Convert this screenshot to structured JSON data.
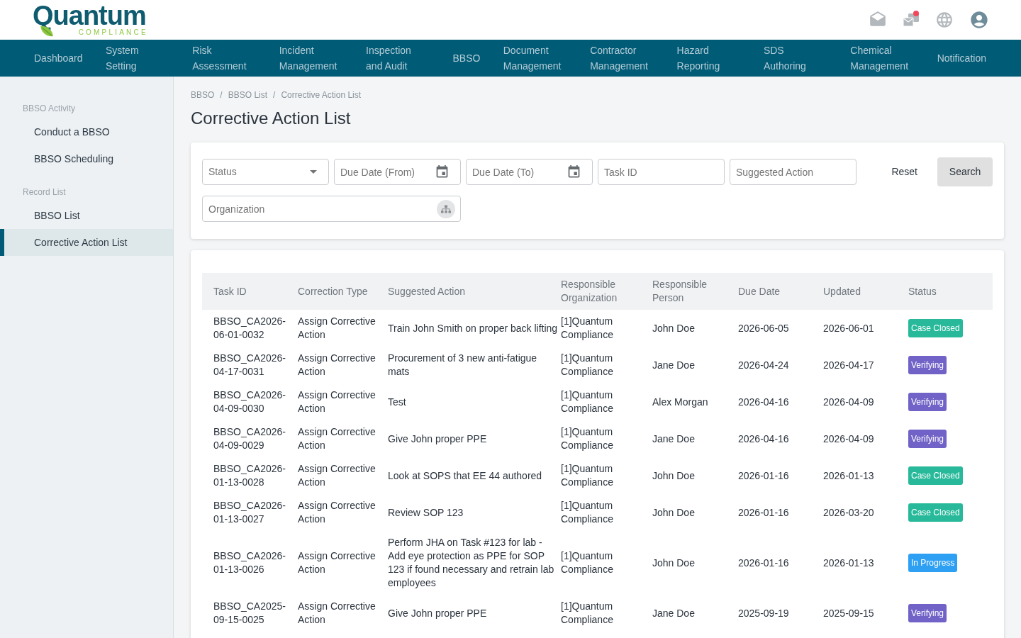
{
  "logo": {
    "name": "Quantum",
    "tagline": "COMPLIANCE"
  },
  "header": {
    "unread": true
  },
  "nav": [
    "Dashboard",
    "System Setting",
    "Risk Assessment",
    "Incident Management",
    "Inspection and Audit",
    "BBSO",
    "Document Management",
    "Contractor Management",
    "Hazard Reporting",
    "SDS Authoring",
    "Chemical Management",
    "Notification"
  ],
  "sidebar": {
    "sections": [
      {
        "title": "BBSO Activity",
        "items": [
          {
            "label": "Conduct a BBSO",
            "selected": false
          },
          {
            "label": "BBSO Scheduling",
            "selected": false
          }
        ]
      },
      {
        "title": "Record List",
        "items": [
          {
            "label": "BBSO List",
            "selected": false
          },
          {
            "label": "Corrective Action List",
            "selected": true
          }
        ]
      }
    ]
  },
  "breadcrumb": {
    "separator": "/",
    "items": [
      "BBSO",
      "BBSO List",
      "Corrective Action List"
    ]
  },
  "page_title": "Corrective Action List",
  "filters": {
    "fields": [
      {
        "kind": "select",
        "placeholder": "Status"
      },
      {
        "kind": "date",
        "placeholder": "Due Date (From)"
      },
      {
        "kind": "date",
        "placeholder": "Due Date (To)"
      },
      {
        "kind": "text",
        "placeholder": "Task ID"
      },
      {
        "kind": "text",
        "placeholder": "Suggested Action"
      },
      {
        "kind": "org",
        "placeholder": "Organization"
      }
    ],
    "buttons": [
      {
        "kind": "plain",
        "label": "Reset"
      },
      {
        "kind": "filled",
        "label": "Search"
      }
    ]
  },
  "table": {
    "columns": [
      "Task ID",
      "Correction Type",
      "Suggested Action",
      "Responsible Organization",
      "Responsible Person",
      "Due Date",
      "Updated",
      "Status"
    ],
    "rows": [
      {
        "task_id": "BBSO_CA2026-06-01-0032",
        "correction_type": "Assign Corrective Action",
        "suggested_action": "Train John Smith on proper back lifting",
        "organization": "[1]Quantum Compliance",
        "person": "John Doe",
        "due_date": "2026-06-05",
        "updated": "2026-06-01",
        "status": {
          "label": "Case Closed",
          "color": "#27b99a"
        }
      },
      {
        "task_id": "BBSO_CA2026-04-17-0031",
        "correction_type": "Assign Corrective Action",
        "suggested_action": "Procurement of 3 new anti-fatigue mats",
        "organization": "[1]Quantum Compliance",
        "person": "Jane Doe",
        "due_date": "2026-04-24",
        "updated": "2026-04-17",
        "status": {
          "label": "Verifying",
          "color": "#7062c6"
        }
      },
      {
        "task_id": "BBSO_CA2026-04-09-0030",
        "correction_type": "Assign Corrective Action",
        "suggested_action": "Test",
        "organization": "[1]Quantum Compliance",
        "person": "Alex Morgan",
        "due_date": "2026-04-16",
        "updated": "2026-04-09",
        "status": {
          "label": "Verifying",
          "color": "#7062c6"
        }
      },
      {
        "task_id": "BBSO_CA2026-04-09-0029",
        "correction_type": "Assign Corrective Action",
        "suggested_action": "Give John proper PPE",
        "organization": "[1]Quantum Compliance",
        "person": "Jane Doe",
        "due_date": "2026-04-16",
        "updated": "2026-04-09",
        "status": {
          "label": "Verifying",
          "color": "#7062c6"
        }
      },
      {
        "task_id": "BBSO_CA2026-01-13-0028",
        "correction_type": "Assign Corrective Action",
        "suggested_action": "Look at SOPS that EE 44 authored",
        "organization": "[1]Quantum Compliance",
        "person": "John Doe",
        "due_date": "2026-01-16",
        "updated": "2026-01-13",
        "status": {
          "label": "Case Closed",
          "color": "#27b99a"
        }
      },
      {
        "task_id": "BBSO_CA2026-01-13-0027",
        "correction_type": "Assign Corrective Action",
        "suggested_action": "Review SOP 123",
        "organization": "[1]Quantum Compliance",
        "person": "John Doe",
        "due_date": "2026-01-16",
        "updated": "2026-03-20",
        "status": {
          "label": "Case Closed",
          "color": "#27b99a"
        }
      },
      {
        "task_id": "BBSO_CA2026-01-13-0026",
        "correction_type": "Assign Corrective Action",
        "suggested_action": "Perform JHA on Task #123 for lab - Add eye protection as PPE for SOP 123 if found necessary and retrain lab employees",
        "organization": "[1]Quantum Compliance",
        "person": "John Doe",
        "due_date": "2026-01-16",
        "updated": "2026-01-13",
        "status": {
          "label": "In Progress",
          "color": "#2ea0f3"
        }
      },
      {
        "task_id": "BBSO_CA2025-09-15-0025",
        "correction_type": "Assign Corrective Action",
        "suggested_action": "Give John proper PPE",
        "organization": "[1]Quantum Compliance",
        "person": "Jane Doe",
        "due_date": "2025-09-19",
        "updated": "2025-09-15",
        "status": {
          "label": "Verifying",
          "color": "#7062c6"
        }
      }
    ]
  }
}
